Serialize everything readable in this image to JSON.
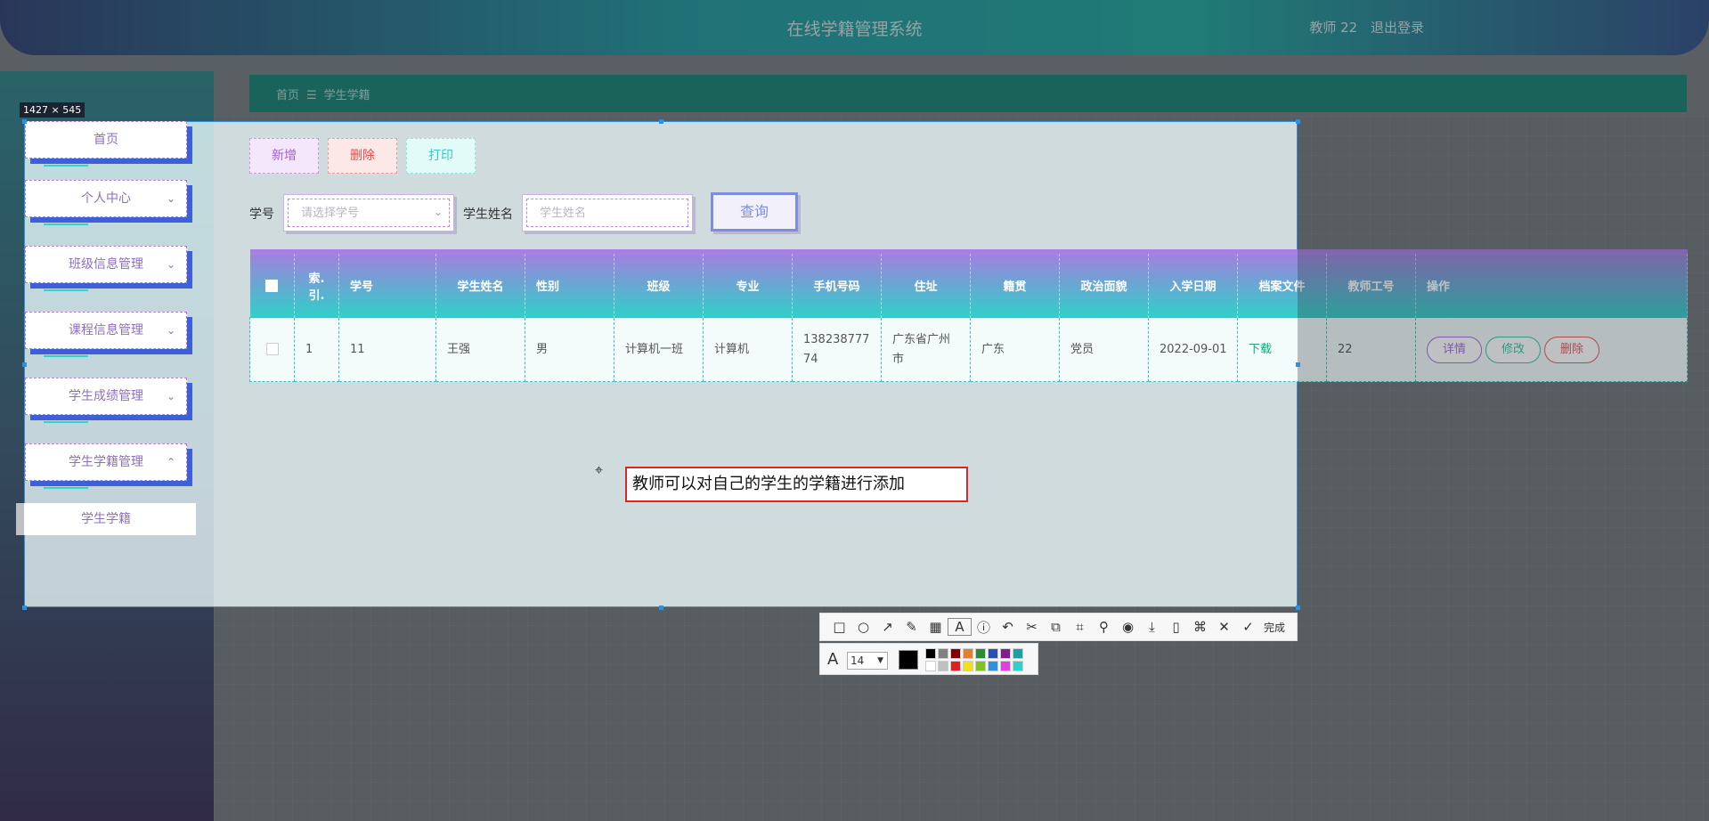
{
  "header": {
    "title": "在线学籍管理系统",
    "user": "教师 22",
    "logout": "退出登录"
  },
  "breadcrumb": {
    "home": "首页",
    "sep": "☰",
    "current": "学生学籍"
  },
  "sidebar": {
    "items": [
      {
        "label": "首页",
        "chevron": ""
      },
      {
        "label": "个人中心",
        "chevron": "⌄"
      },
      {
        "label": "班级信息管理",
        "chevron": "⌄"
      },
      {
        "label": "课程信息管理",
        "chevron": "⌄"
      },
      {
        "label": "学生成绩管理",
        "chevron": "⌄"
      },
      {
        "label": "学生学籍管理",
        "chevron": "⌃"
      }
    ],
    "sub_item": "学生学籍"
  },
  "toolbar": {
    "add": "新增",
    "delete": "删除",
    "print": "打印"
  },
  "search": {
    "student_no_label": "学号",
    "student_no_placeholder": "请选择学号",
    "student_name_label": "学生姓名",
    "student_name_placeholder": "学生姓名",
    "query": "查询"
  },
  "table": {
    "headers": [
      "索引",
      "学号",
      "学生姓名",
      "性别",
      "班级",
      "专业",
      "手机号码",
      "住址",
      "籍贯",
      "政治面貌",
      "入学日期",
      "档案文件",
      "教师工号",
      "操作"
    ],
    "index_header_lines": [
      "索.",
      "引."
    ],
    "rows": [
      {
        "index": "1",
        "student_no": "11",
        "name": "王强",
        "gender": "男",
        "class": "计算机一班",
        "major": "计算机",
        "phone_line1": "138238777",
        "phone_line2": "74",
        "address_line1": "广东省广州",
        "address_line2": "市",
        "native_place": "广东",
        "political_status": "党员",
        "enroll_date": "2022-09-01",
        "file": "下载",
        "teacher_no": "22",
        "ops": {
          "detail": "详情",
          "edit": "修改",
          "delete": "删除"
        }
      }
    ]
  },
  "capture_tool": {
    "size_label": "1427 × 545",
    "annotation_text": "教师可以对自己的学生的学籍进行添加",
    "done": "完成",
    "font_size": "14",
    "colors": [
      "#000000",
      "#808080",
      "#800000",
      "#e08030",
      "#2a8a3a",
      "#2a4fb0",
      "#80208a",
      "#1aa0a0",
      "#ffffff",
      "#c0c0c0",
      "#e02020",
      "#f0e020",
      "#80c020",
      "#3090e0",
      "#e040e0",
      "#30d0d0"
    ]
  }
}
